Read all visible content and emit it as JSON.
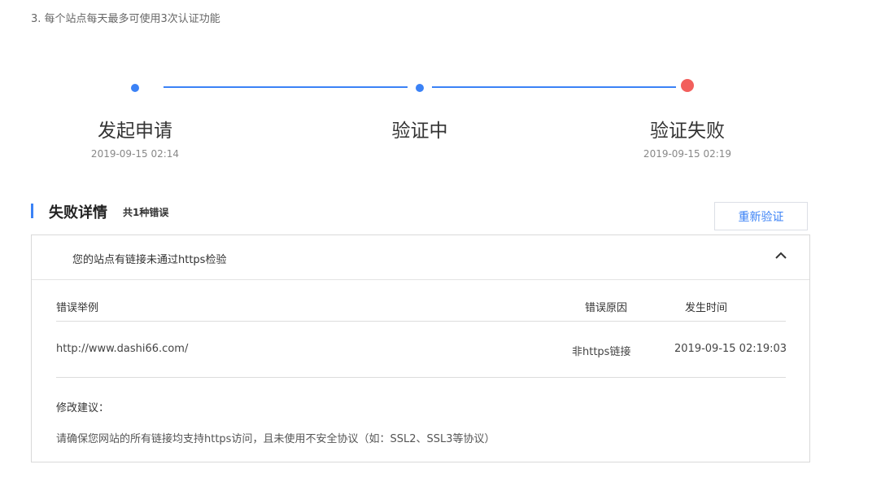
{
  "note": "3. 每个站点每天最多可使用3次认证功能",
  "steps": [
    {
      "label": "发起申请",
      "time": "2019-09-15 02:14",
      "status": "done"
    },
    {
      "label": "验证中",
      "time": "",
      "status": "done"
    },
    {
      "label": "验证失败",
      "time": "2019-09-15 02:19",
      "status": "failed"
    }
  ],
  "colors": {
    "accent": "#3b82f6",
    "error": "#f25f5c"
  },
  "section": {
    "title": "失败详情",
    "count": "共1种错误"
  },
  "retry_button": "重新验证",
  "panel": {
    "heading": "您的站点有链接未通过https检验",
    "collapse_icon": "chevron-up-icon",
    "columns": [
      "错误举例",
      "错误原因",
      "发生时间"
    ],
    "rows": [
      {
        "example": "http://www.dashi66.com/",
        "reason": "非https链接",
        "time": "2019-09-15 02:19:03"
      }
    ],
    "advice_title": "修改建议：",
    "advice_text": "请确保您网站的所有链接均支持https访问，且未使用不安全协议（如：SSL2、SSL3等协议）"
  }
}
